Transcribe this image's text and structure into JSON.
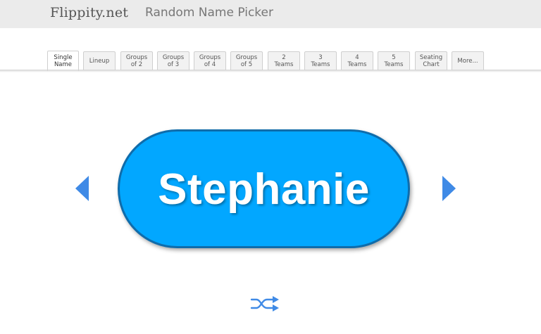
{
  "header": {
    "logo": "Flippity.net",
    "title": "Random Name Picker"
  },
  "tabs": [
    {
      "label": "Single\nName",
      "active": true
    },
    {
      "label": "Lineup"
    },
    {
      "label": "Groups\nof 2"
    },
    {
      "label": "Groups\nof 3"
    },
    {
      "label": "Groups\nof 4"
    },
    {
      "label": "Groups\nof 5"
    },
    {
      "label": "2\nTeams"
    },
    {
      "label": "3\nTeams"
    },
    {
      "label": "4\nTeams"
    },
    {
      "label": "5\nTeams"
    },
    {
      "label": "Seating\nChart"
    },
    {
      "label": "More..."
    }
  ],
  "picker": {
    "current_name": "Stephanie"
  },
  "icons": {
    "prev": "triangle-left-icon",
    "next": "triangle-right-icon",
    "shuffle": "shuffle-icon"
  },
  "colors": {
    "accent": "#02a7ff",
    "pill_border": "#0f6cab",
    "arrow": "#3f8ae6",
    "header_bg": "#ebebeb"
  }
}
